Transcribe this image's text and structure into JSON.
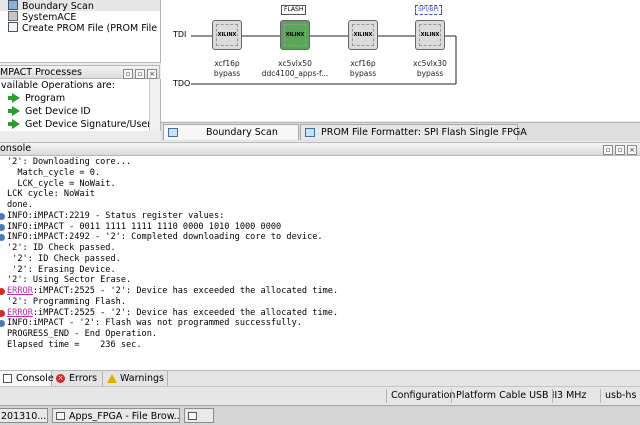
{
  "flows": {
    "items": [
      {
        "label": "Boundary Scan",
        "selected": true
      },
      {
        "label": "SystemACE",
        "selected": false
      },
      {
        "label": "Create PROM File (PROM File ...",
        "selected": false
      }
    ]
  },
  "processes": {
    "title": "MPACT Processes",
    "subtitle": "vailable Operations are:",
    "items": [
      "Program",
      "Get Device ID",
      "Get Device Signature/Usercode"
    ]
  },
  "canvas": {
    "tdi_label": "TDI",
    "tdo_label": "TDO",
    "devices": [
      {
        "chip_label": "XILINX",
        "name": "xcf16p",
        "mode": "bypass",
        "selected": false,
        "tag": ""
      },
      {
        "chip_label": "XILINX",
        "name": "xc5vlx50",
        "mode": "ddc4100_apps-f...",
        "selected": true,
        "tag": "FLASH"
      },
      {
        "chip_label": "XILINX",
        "name": "xcf16p",
        "mode": "bypass",
        "selected": false,
        "tag": ""
      },
      {
        "chip_label": "XILINX",
        "name": "xc5vlx30",
        "mode": "bypass",
        "selected": false,
        "tag": "SPI/BPI"
      }
    ]
  },
  "tabs": [
    {
      "label": "Boundary Scan",
      "active": true
    },
    {
      "label": "PROM File Formatter: SPI Flash Single FPGA",
      "active": false
    }
  ],
  "console": {
    "title": "onsole",
    "lines": [
      {
        "text": "'2': Downloading core...",
        "type": "plain"
      },
      {
        "text": "  Match_cycle = 0.",
        "type": "plain"
      },
      {
        "text": "  LCK_cycle = NoWait.",
        "type": "plain"
      },
      {
        "text": "LCK cycle: NoWait",
        "type": "plain"
      },
      {
        "text": "done.",
        "type": "plain"
      },
      {
        "text": "INFO:iMPACT:2219 - Status register values:",
        "type": "info"
      },
      {
        "text": "INFO:iMPACT - 0011 1111 1111 1110 0000 1010 1000 0000",
        "type": "info"
      },
      {
        "text": "INFO:iMPACT:2492 - '2': Completed downloading core to device.",
        "type": "info"
      },
      {
        "text": "'2': ID Check passed.",
        "type": "plain"
      },
      {
        "text": " '2': ID Check passed.",
        "type": "plain"
      },
      {
        "text": " '2': Erasing Device.",
        "type": "plain"
      },
      {
        "text": "'2': Using Sector Erase.",
        "type": "plain"
      },
      {
        "prefix": "ERROR",
        "text": ":iMPACT:2525 - '2': Device has exceeded the allocated time.",
        "type": "error"
      },
      {
        "text": "'2': Programming Flash.",
        "type": "plain"
      },
      {
        "prefix": "ERROR",
        "text": ":iMPACT:2525 - '2': Device has exceeded the allocated time.",
        "type": "error"
      },
      {
        "text": "INFO:iMPACT - '2': Flash was not programmed successfully.",
        "type": "info"
      },
      {
        "text": "PROGRESS_END - End Operation.",
        "type": "plain"
      },
      {
        "text": "Elapsed time =    236 sec.",
        "type": "plain"
      }
    ]
  },
  "console_tabs": [
    {
      "label": "Console",
      "icon": "console-icon",
      "active": true
    },
    {
      "label": "Errors",
      "icon": "error-icon",
      "active": false
    },
    {
      "label": "Warnings",
      "icon": "warning-icon",
      "active": false
    }
  ],
  "status": {
    "mode": "Configuration",
    "cable": "Platform Cable USB II",
    "speed": "3 MHz",
    "port": "usb-hs"
  },
  "taskbar": [
    {
      "label": "201310...",
      "icon": "window-icon"
    },
    {
      "label": "Apps_FPGA - File Brow...",
      "icon": "folder-icon"
    },
    {
      "label": "",
      "icon": "window-icon"
    }
  ],
  "colors": {
    "selected_chip": "#5aa55a",
    "error": "#cf2b2b",
    "info": "#4a7ab8",
    "error_link": "#c42bb0"
  }
}
